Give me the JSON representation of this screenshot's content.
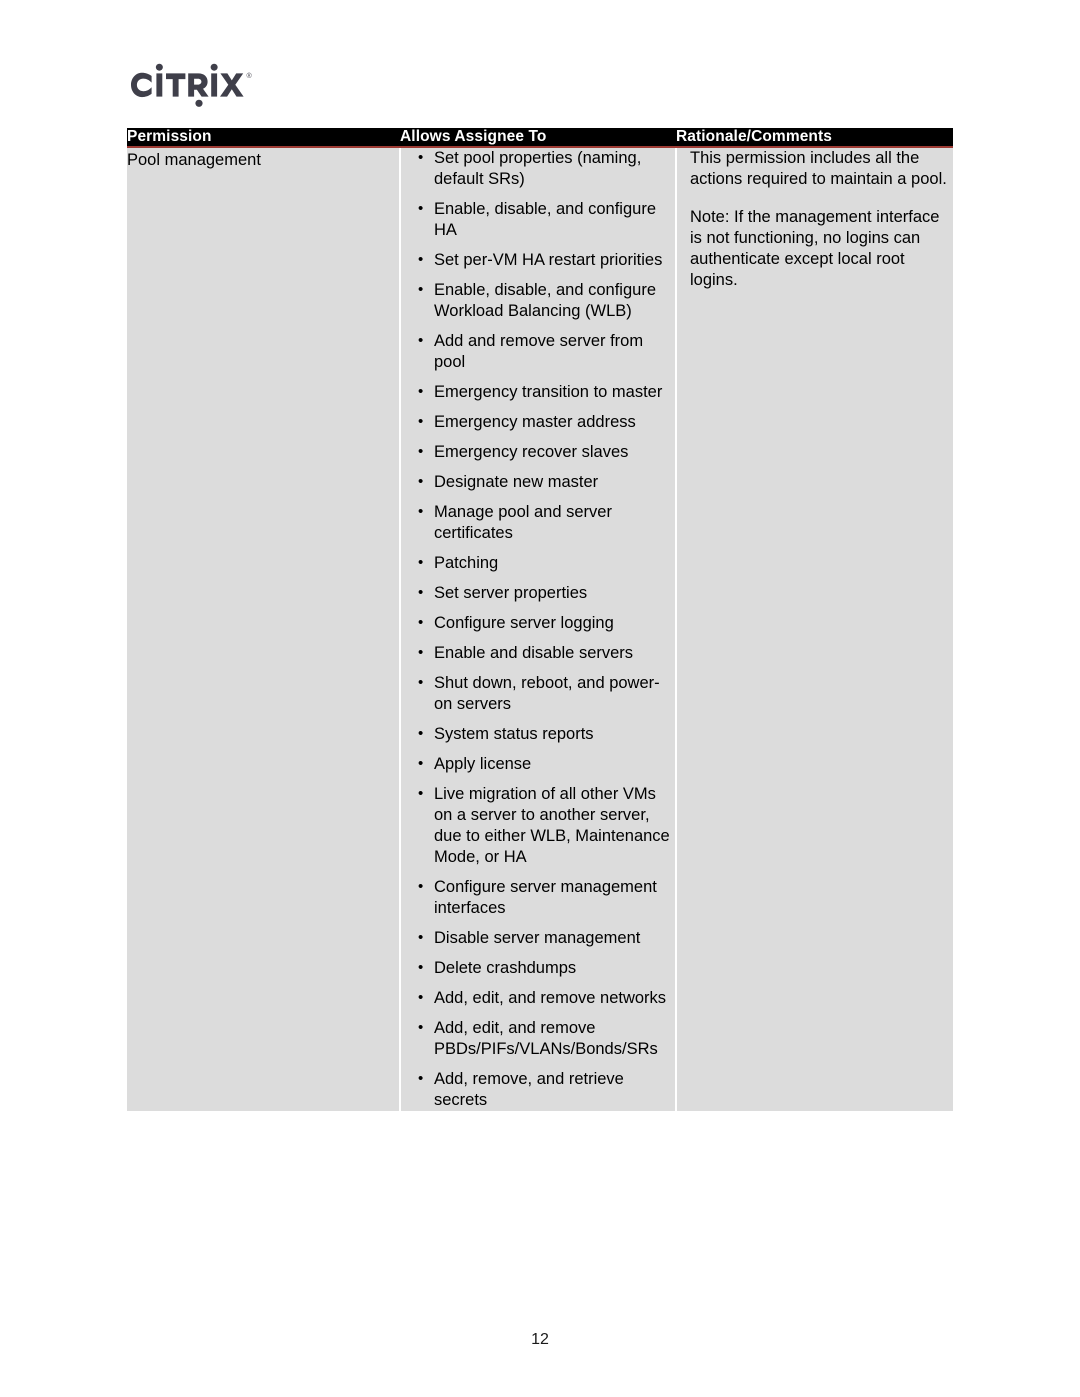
{
  "document": {
    "page_number": "12",
    "brand": {
      "logo_text": "CITRIX",
      "logo_color": "#3f3f4a",
      "trademark": "®"
    }
  },
  "table": {
    "header_background": "#000000",
    "header_text_color": "#ffffff",
    "accent_rule_color": "#9e3b34",
    "cell_background": "#dcdcdc",
    "divider_color": "#ffffff",
    "columns": [
      "Permission",
      "Allows Assignee To",
      "Rationale/Comments"
    ],
    "rows": [
      {
        "permission": "Pool management",
        "allows_assignee_to": [
          "Set pool properties (naming, default SRs)",
          "Enable, disable, and configure HA",
          "Set per-VM HA restart priorities",
          "Enable, disable, and configure Workload Balancing (WLB)",
          "Add and remove server from pool",
          "Emergency transition to master",
          "Emergency master address",
          "Emergency recover slaves",
          "Designate new master",
          "Manage pool and server certificates",
          "Patching",
          "Set server properties",
          "Configure server logging",
          "Enable and disable servers",
          "Shut down, reboot, and power-on servers",
          "System status reports",
          "Apply license",
          "Live migration of all other VMs on a server to another server, due to either WLB, Maintenance Mode, or HA",
          "Configure server management interfaces",
          "Disable server management",
          "Delete crashdumps",
          "Add, edit, and remove networks",
          "Add, edit, and remove PBDs/PIFs/VLANs/Bonds/SRs",
          "Add, remove, and retrieve secrets"
        ],
        "rationale": [
          "This permission includes all the actions required to maintain a pool.",
          "Note: If the management interface is not functioning, no logins can authenticate except local root logins."
        ]
      }
    ]
  }
}
